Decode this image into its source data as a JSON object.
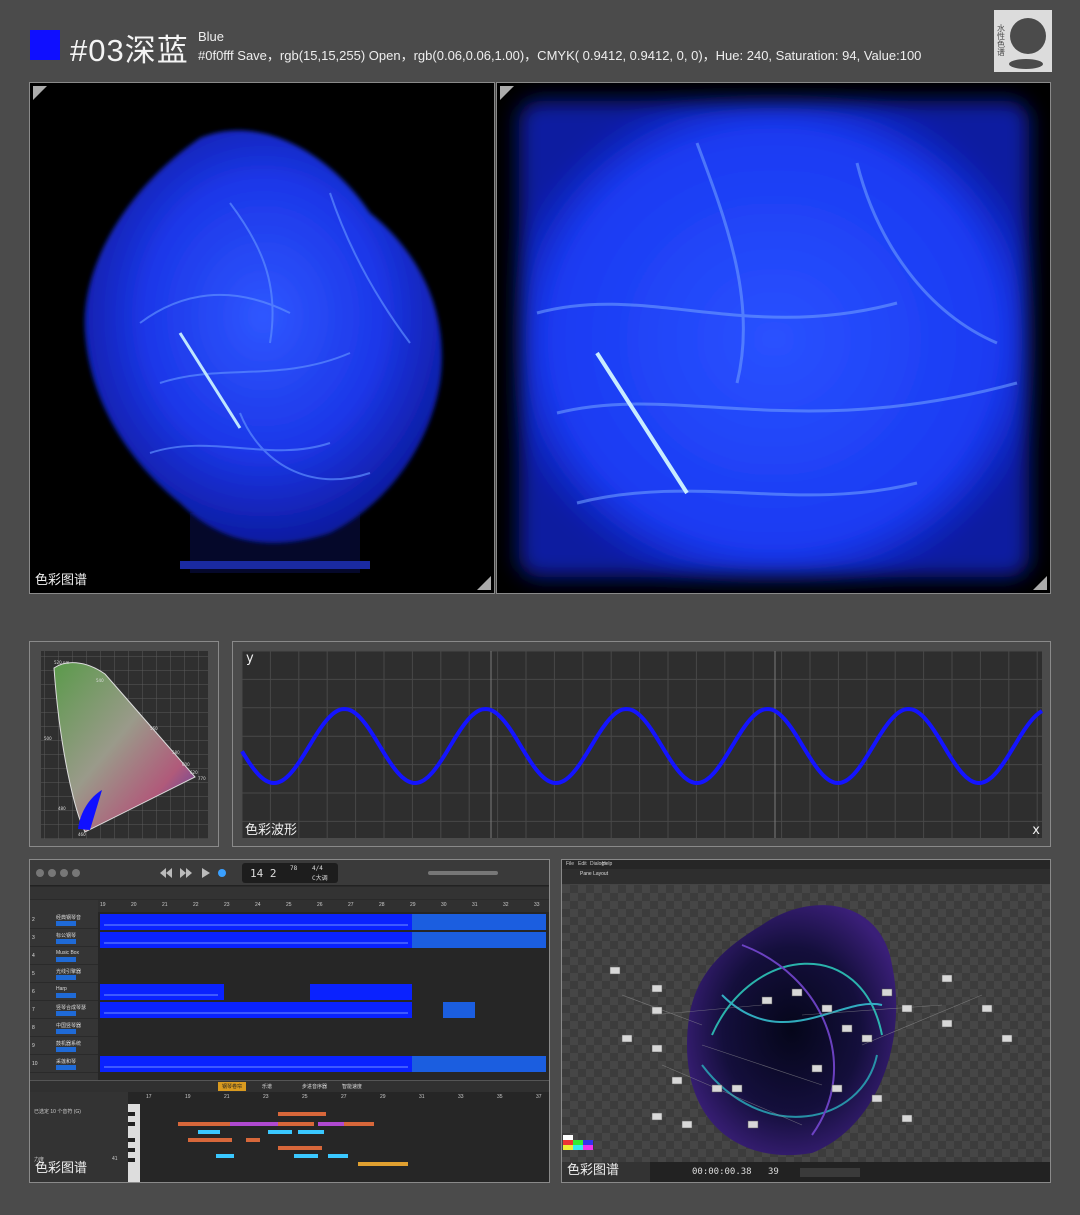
{
  "header": {
    "swatch_color": "#0f0fff",
    "title": "#03深蓝",
    "subtitle": "Blue",
    "codes": "#0f0fff Save，rgb(15,15,255) Open，rgb(0.06,0.06,1.00)，CMYK( 0.9412, 0.9412, 0, 0)，Hue: 240, Saturation: 94, Value:100",
    "logo_text": "水性色谱"
  },
  "panels": {
    "photo_left_caption": "色彩图谱",
    "chromaticity": {
      "tick_labels": [
        "520 nm",
        "540",
        "560",
        "580",
        "600",
        "620",
        "770",
        "500",
        "480",
        "460"
      ]
    },
    "waveform": {
      "caption": "色彩波形",
      "y_label": "y",
      "x_label": "x",
      "line_color": "#1414ff"
    },
    "daw": {
      "caption": "色彩图谱",
      "tracks": [
        {
          "num": "2",
          "name": "经典钢琴音"
        },
        {
          "num": "3",
          "name": "标公钢琴"
        },
        {
          "num": "4",
          "name": "Music Box"
        },
        {
          "num": "5",
          "name": "光线引擎器"
        },
        {
          "num": "6",
          "name": "Harp"
        },
        {
          "num": "7",
          "name": "竖琴合成琴瑟"
        },
        {
          "num": "8",
          "name": "中国竖琴器"
        },
        {
          "num": "9",
          "name": "鼓机器系统"
        },
        {
          "num": "10",
          "name": "采莲和琴"
        }
      ],
      "lcd_bar": "14 2",
      "lcd_tempo": "78",
      "lcd_sig": "4/4",
      "lcd_key": "C大调",
      "ruler": [
        "19",
        "20",
        "21",
        "22",
        "23",
        "24",
        "25",
        "26",
        "27",
        "28",
        "29",
        "30",
        "31",
        "32",
        "33"
      ],
      "editor_tabs": [
        "钢琴卷帘",
        "乐谱",
        "步进音序器",
        "智能速度"
      ],
      "editor_info": "已选定 10 个音符 (G)",
      "editor_ruler": [
        "17",
        "19",
        "21",
        "23",
        "25",
        "27",
        "29",
        "31",
        "33",
        "35",
        "37"
      ],
      "editor_labels": [
        "力度",
        "41"
      ]
    },
    "node": {
      "caption": "色彩图谱",
      "menu": [
        "File",
        "Edit",
        "Dialogs",
        "Help"
      ],
      "timecode": "00:00:00.38",
      "frame": "39",
      "tab": "Pane Layout"
    }
  }
}
